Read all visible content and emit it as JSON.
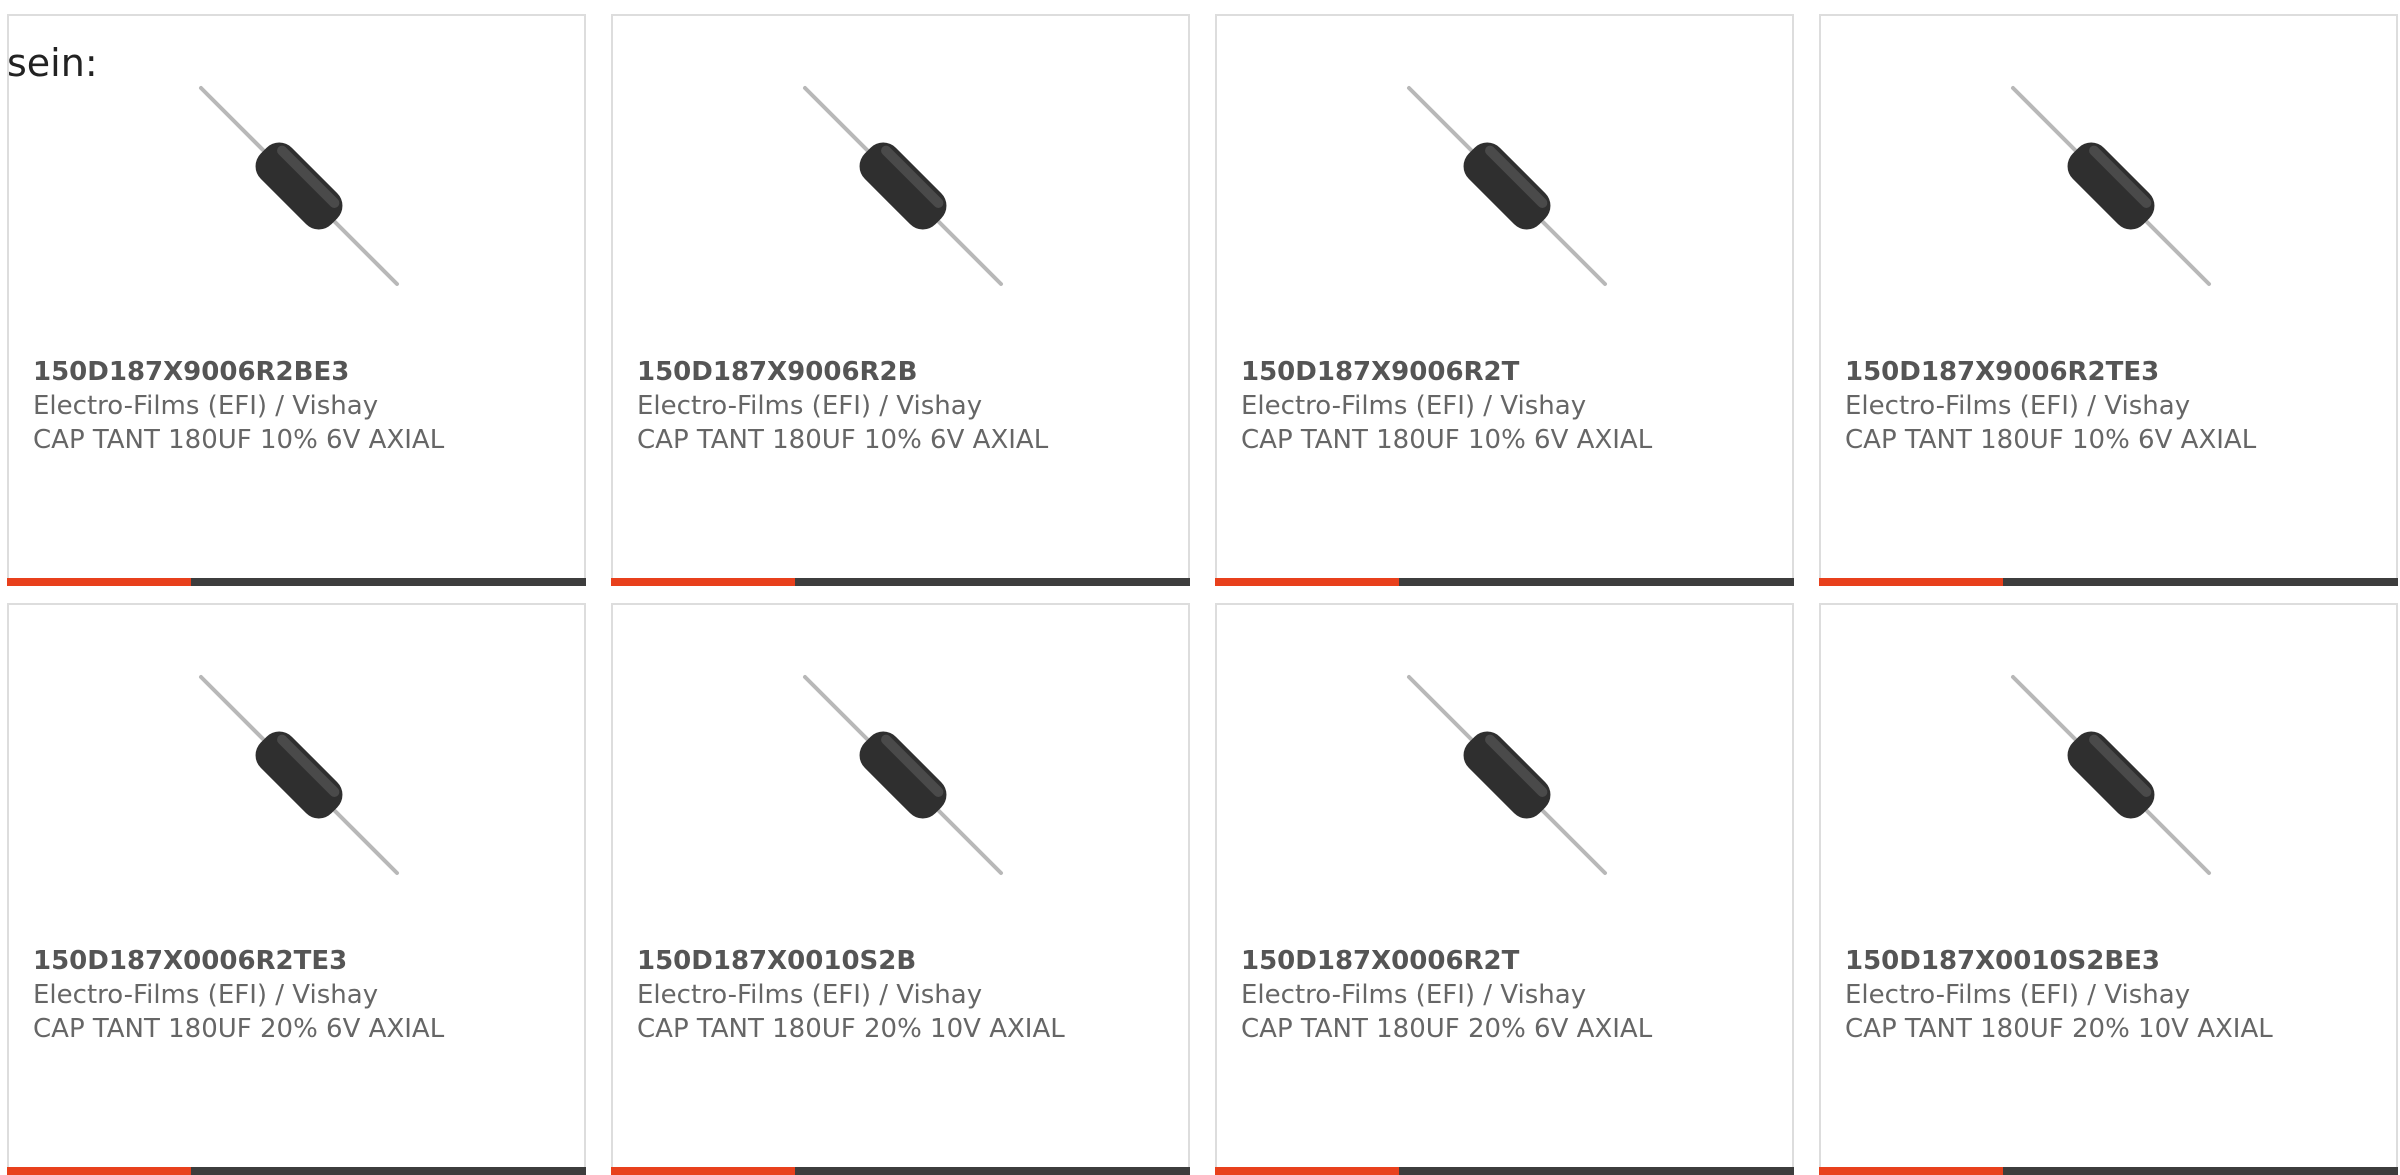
{
  "intro_text": "sein:",
  "colors": {
    "accent": "#e8401c",
    "bar_dark": "#3d3d3d",
    "part_number": "#555555",
    "body_text": "#666666",
    "card_border": "#dddddd"
  },
  "products": [
    {
      "part_number": "150D187X9006R2BE3",
      "manufacturer": "Electro-Films (EFI) / Vishay",
      "description": "CAP TANT 180UF 10% 6V AXIAL",
      "image_icon": "axial-capacitor-icon"
    },
    {
      "part_number": "150D187X9006R2B",
      "manufacturer": "Electro-Films (EFI) / Vishay",
      "description": "CAP TANT 180UF 10% 6V AXIAL",
      "image_icon": "axial-capacitor-icon"
    },
    {
      "part_number": "150D187X9006R2T",
      "manufacturer": "Electro-Films (EFI) / Vishay",
      "description": "CAP TANT 180UF 10% 6V AXIAL",
      "image_icon": "axial-capacitor-icon"
    },
    {
      "part_number": "150D187X9006R2TE3",
      "manufacturer": "Electro-Films (EFI) / Vishay",
      "description": "CAP TANT 180UF 10% 6V AXIAL",
      "image_icon": "axial-capacitor-icon"
    },
    {
      "part_number": "150D187X0006R2TE3",
      "manufacturer": "Electro-Films (EFI) / Vishay",
      "description": "CAP TANT 180UF 20% 6V AXIAL",
      "image_icon": "axial-capacitor-icon"
    },
    {
      "part_number": "150D187X0010S2B",
      "manufacturer": "Electro-Films (EFI) / Vishay",
      "description": "CAP TANT 180UF 20% 10V AXIAL",
      "image_icon": "axial-capacitor-icon"
    },
    {
      "part_number": "150D187X0006R2T",
      "manufacturer": "Electro-Films (EFI) / Vishay",
      "description": "CAP TANT 180UF 20% 6V AXIAL",
      "image_icon": "axial-capacitor-icon"
    },
    {
      "part_number": "150D187X0010S2BE3",
      "manufacturer": "Electro-Films (EFI) / Vishay",
      "description": "CAP TANT 180UF 20% 10V AXIAL",
      "image_icon": "axial-capacitor-icon"
    }
  ]
}
